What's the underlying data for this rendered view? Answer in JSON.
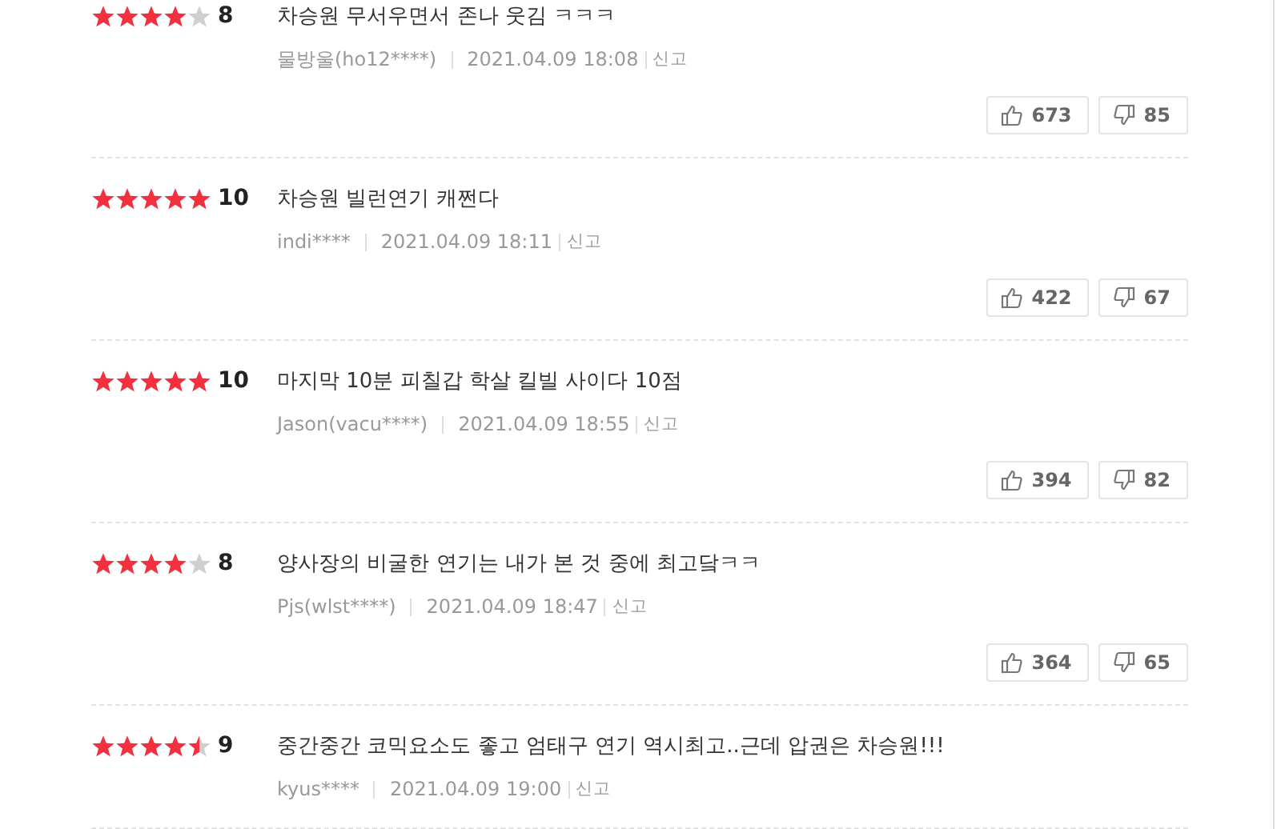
{
  "reviews": [
    {
      "stars": 4,
      "score": "8",
      "text": "차승원 무서우면서 존나 웃김 ㅋㅋㅋ",
      "author": "물방울(ho12****)",
      "date": "2021.04.09 18:08",
      "report": "신고",
      "likes": "673",
      "dislikes": "85"
    },
    {
      "stars": 5,
      "score": "10",
      "text": "차승원 빌런연기 캐쩐다",
      "author": "indi****",
      "date": "2021.04.09 18:11",
      "report": "신고",
      "likes": "422",
      "dislikes": "67"
    },
    {
      "stars": 5,
      "score": "10",
      "text": "마지막 10분 피칠갑 학살 킬빌 사이다 10점",
      "author": "Jason(vacu****)",
      "date": "2021.04.09 18:55",
      "report": "신고",
      "likes": "394",
      "dislikes": "82"
    },
    {
      "stars": 4,
      "score": "8",
      "text": "양사장의 비굴한 연기는 내가 본 것 중에 최고닼ㅋㅋ",
      "author": "Pjs(wlst****)",
      "date": "2021.04.09 18:47",
      "report": "신고",
      "likes": "364",
      "dislikes": "65"
    },
    {
      "stars": 4.5,
      "score": "9",
      "text": "중간중간 코믹요소도 좋고 엄태구 연기 역시최고..근데 압권은 차승원!!!",
      "author": "kyus****",
      "date": "2021.04.09 19:00",
      "report": "신고"
    }
  ]
}
